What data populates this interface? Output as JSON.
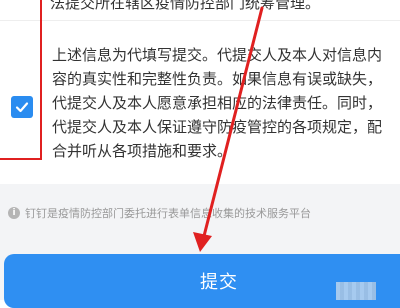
{
  "top_text": "法提交所在辖区疫情防控部门统筹管理。",
  "consent": {
    "checked": true,
    "lines": [
      "上述信息为代填写提交。代提交人及本人对信息内",
      "容的真实性和完整性负责。如果信息有误或缺失，",
      "代提交人及本人愿意承担相应的法律责任。同时，",
      "代提交人及本人保证遵守防疫管控的各项规定，配",
      "合并听从各项措施和要求。"
    ]
  },
  "footer_note": {
    "icon": "info-icon",
    "text": "钉钉是疫情防控部门委托进行表单信息收集的技术服务平台"
  },
  "submit_label": "提交",
  "colors": {
    "accent": "#2f8ff2",
    "annotation": "#e02020"
  }
}
